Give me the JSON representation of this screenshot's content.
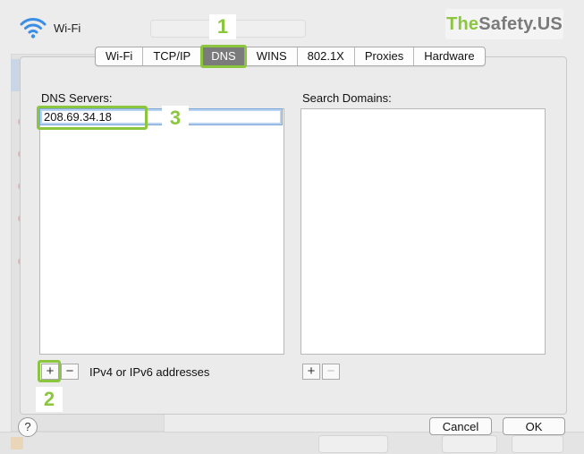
{
  "window": {
    "title": "Wi-Fi"
  },
  "brand": {
    "part1": "The",
    "part2": "Safety",
    "part3": ".US",
    "accent_color": "#8cc63f"
  },
  "tabs": [
    {
      "label": "Wi-Fi",
      "active": false
    },
    {
      "label": "TCP/IP",
      "active": false
    },
    {
      "label": "DNS",
      "active": true
    },
    {
      "label": "WINS",
      "active": false
    },
    {
      "label": "802.1X",
      "active": false
    },
    {
      "label": "Proxies",
      "active": false
    },
    {
      "label": "Hardware",
      "active": false
    }
  ],
  "dns": {
    "label": "DNS Servers:",
    "entries": [
      "208.69.34.18"
    ],
    "add_label": "+",
    "remove_label": "−",
    "hint": "IPv4 or IPv6 addresses"
  },
  "search_domains": {
    "label": "Search Domains:",
    "add_label": "+",
    "remove_label": "−"
  },
  "callouts": [
    "1",
    "2",
    "3"
  ],
  "footer": {
    "help_label": "?",
    "cancel_label": "Cancel",
    "ok_label": "OK"
  }
}
